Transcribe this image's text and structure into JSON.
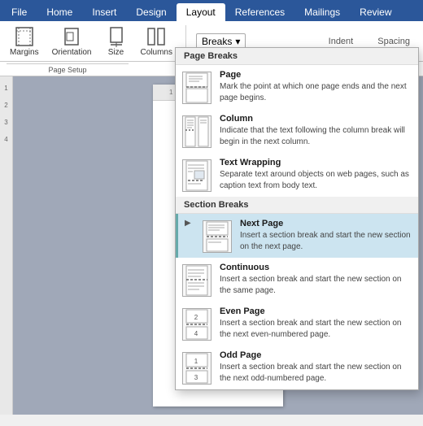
{
  "tabs": [
    {
      "label": "File",
      "active": false
    },
    {
      "label": "Home",
      "active": false
    },
    {
      "label": "Insert",
      "active": false
    },
    {
      "label": "Design",
      "active": false
    },
    {
      "label": "Layout",
      "active": true
    },
    {
      "label": "References",
      "active": false
    },
    {
      "label": "Mailings",
      "active": false
    },
    {
      "label": "Review",
      "active": false
    }
  ],
  "ribbon": {
    "breaks_label": "Breaks",
    "indent_label": "Indent",
    "spacing_label": "Spacing",
    "page_setup_label": "Page Setup",
    "margins_label": "Margins",
    "orientation_label": "Orientation",
    "size_label": "Size",
    "columns_label": "Columns"
  },
  "menu": {
    "page_breaks_header": "Page Breaks",
    "section_breaks_header": "Section Breaks",
    "items": [
      {
        "id": "page",
        "title": "Page",
        "description": "Mark the point at which one page ends and the next page begins.",
        "active": false
      },
      {
        "id": "column",
        "title": "Column",
        "description": "Indicate that the text following the column break will begin in the next column.",
        "active": false
      },
      {
        "id": "text-wrapping",
        "title": "Text Wrapping",
        "description": "Separate text around objects on web pages, such as caption text from body text.",
        "active": false
      },
      {
        "id": "next-page",
        "title": "Next Page",
        "description": "Insert a section break and start the new section on the next page.",
        "active": true
      },
      {
        "id": "continuous",
        "title": "Continuous",
        "description": "Insert a section break and start the new section on the same page.",
        "active": false
      },
      {
        "id": "even-page",
        "title": "Even Page",
        "description": "Insert a section break and start the new section on the next even-numbered page.",
        "active": false
      },
      {
        "id": "odd-page",
        "title": "Odd Page",
        "description": "Insert a section break and start the new section on the next odd-numbered page.",
        "active": false
      }
    ]
  }
}
